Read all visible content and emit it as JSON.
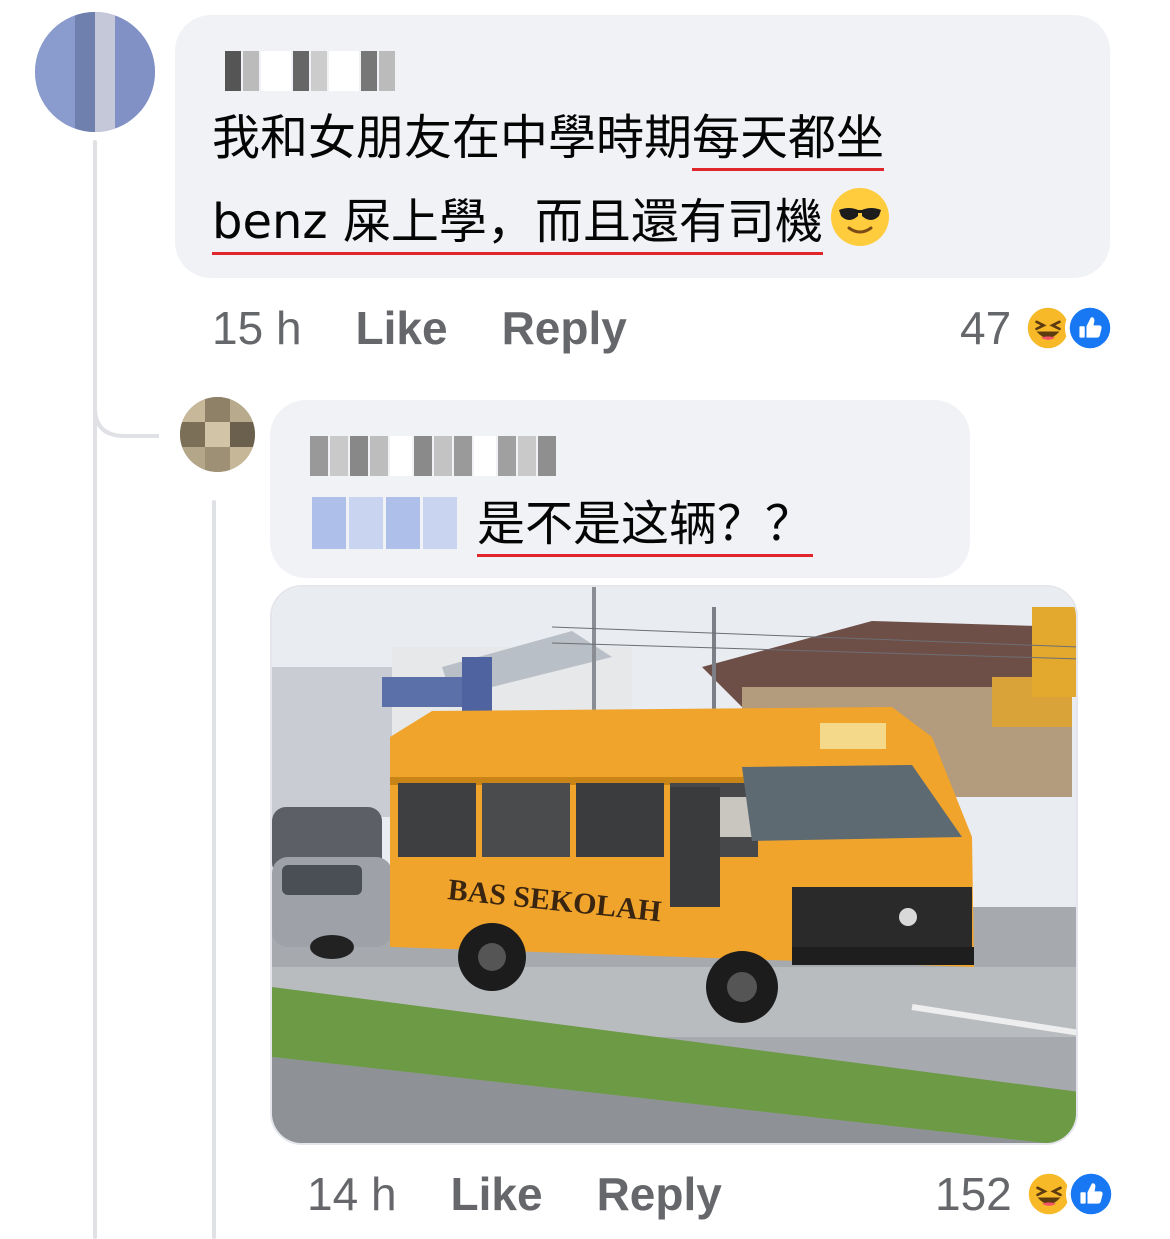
{
  "comments": [
    {
      "author": "",
      "text_plain": "我和女朋友在中學時期",
      "text_underlined_1": "每天都坐",
      "text_underlined_2": "benz 屎上學，而且還有司機",
      "emoji": "smiling-face-with-sunglasses",
      "time": "15 h",
      "like_label": "Like",
      "reply_label": "Reply",
      "reaction_count": "47",
      "reactions": [
        "haha",
        "like"
      ]
    },
    {
      "author": "",
      "mention": "",
      "text_underlined": "是不是这辆？？",
      "photo_text": {
        "side": "BAS SEKOLAH"
      },
      "time": "14 h",
      "like_label": "Like",
      "reply_label": "Reply",
      "reaction_count": "152",
      "reactions": [
        "haha",
        "like"
      ]
    }
  ],
  "colors": {
    "bubble": "#f0f2f5",
    "meta_text": "#65676b",
    "underline": "#e0262b",
    "like_blue": "#1877f2",
    "haha_yellow": "#f7b928",
    "thread_line": "#dfe1e5"
  }
}
